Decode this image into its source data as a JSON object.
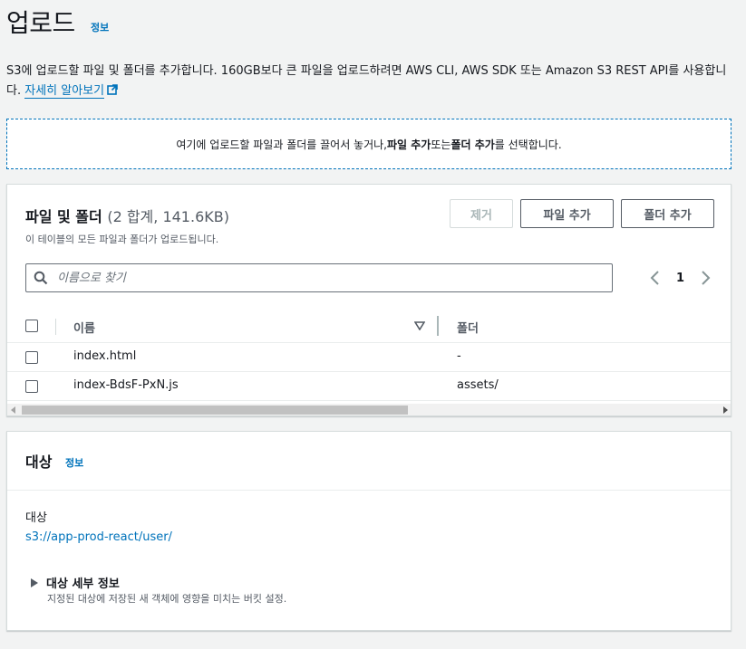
{
  "header": {
    "title": "업로드",
    "info_link": "정보"
  },
  "description": {
    "text": "S3에 업로드할 파일 및 폴더를 추가합니다. 160GB보다 큰 파일을 업로드하려면 AWS CLI, AWS SDK 또는 Amazon S3 REST API를 사용합니다. ",
    "learn_more": "자세히 알아보기"
  },
  "dropzone": {
    "text_before": "여기에 업로드할 파일과 폴더를 끌어서 놓거나, ",
    "add_files": "파일 추가",
    "text_or": " 또는 ",
    "add_folder": "폴더 추가",
    "text_after": "를 선택합니다."
  },
  "files_panel": {
    "title": "파일 및 폴더",
    "count": "(2 합계, 141.6KB)",
    "subtitle": "이 테이블의 모든 파일과 폴더가 업로드됩니다.",
    "buttons": {
      "remove": "제거",
      "add_files": "파일 추가",
      "add_folder": "폴더 추가"
    },
    "search": {
      "placeholder": "이름으로 찾기",
      "value": ""
    },
    "pagination": {
      "current_page": "1"
    },
    "columns": {
      "name": "이름",
      "folder": "폴더"
    },
    "rows": [
      {
        "name": "index.html",
        "folder": "-"
      },
      {
        "name": "index-BdsF-PxN.js",
        "folder": "assets/"
      }
    ]
  },
  "destination": {
    "title": "대상",
    "info_link": "정보",
    "label": "대상",
    "path": "s3://app-prod-react/user/",
    "details_title": "대상 세부 정보",
    "details_desc": "지정된 대상에 저장된 새 객체에 영향을 미치는 버킷 설정."
  },
  "colors": {
    "link": "#0073bb",
    "text": "#16191f",
    "muted": "#545b64",
    "background": "#f2f3f3",
    "border": "#d5dbdb"
  },
  "icons": [
    "external-link-icon",
    "search-icon",
    "chevron-left-icon",
    "chevron-right-icon",
    "sort-down-icon",
    "caret-right-icon",
    "scroll-left-icon",
    "scroll-right-icon"
  ]
}
